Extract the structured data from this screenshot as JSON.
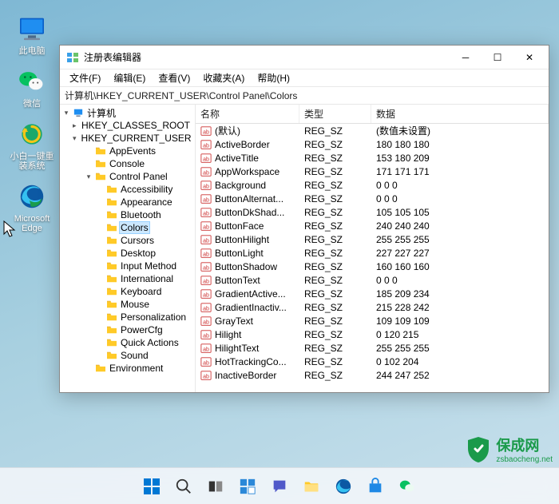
{
  "desktop": {
    "icons": [
      {
        "name": "此电脑",
        "kind": "pc"
      },
      {
        "name": "微信",
        "kind": "wechat"
      },
      {
        "name": "小白一键重装系统",
        "kind": "reinstall"
      },
      {
        "name": "Microsoft Edge",
        "kind": "edge"
      }
    ]
  },
  "window": {
    "title": "注册表编辑器",
    "menu": [
      "文件(F)",
      "编辑(E)",
      "查看(V)",
      "收藏夹(A)",
      "帮助(H)"
    ],
    "path": "计算机\\HKEY_CURRENT_USER\\Control Panel\\Colors",
    "tree_root": "计算机",
    "tree": {
      "hkcr": "HKEY_CLASSES_ROOT",
      "hkcu": "HKEY_CURRENT_USER",
      "hkcu_children": [
        "AppEvents",
        "Console",
        {
          "label": "Control Panel",
          "expanded": true,
          "children": [
            "Accessibility",
            "Appearance",
            "Bluetooth",
            {
              "label": "Colors",
              "selected": true
            },
            "Cursors",
            "Desktop",
            "Input Method",
            "International",
            "Keyboard",
            "Mouse",
            "Personalization",
            "PowerCfg",
            "Quick Actions",
            "Sound"
          ]
        },
        "Environment"
      ]
    },
    "list": {
      "headers": {
        "name": "名称",
        "type": "类型",
        "data": "数据"
      },
      "rows": [
        {
          "name": "(默认)",
          "type": "REG_SZ",
          "data": "(数值未设置)"
        },
        {
          "name": "ActiveBorder",
          "type": "REG_SZ",
          "data": "180 180 180"
        },
        {
          "name": "ActiveTitle",
          "type": "REG_SZ",
          "data": "153 180 209"
        },
        {
          "name": "AppWorkspace",
          "type": "REG_SZ",
          "data": "171 171 171"
        },
        {
          "name": "Background",
          "type": "REG_SZ",
          "data": "0 0 0"
        },
        {
          "name": "ButtonAlternat...",
          "type": "REG_SZ",
          "data": "0 0 0"
        },
        {
          "name": "ButtonDkShad...",
          "type": "REG_SZ",
          "data": "105 105 105"
        },
        {
          "name": "ButtonFace",
          "type": "REG_SZ",
          "data": "240 240 240"
        },
        {
          "name": "ButtonHilight",
          "type": "REG_SZ",
          "data": "255 255 255"
        },
        {
          "name": "ButtonLight",
          "type": "REG_SZ",
          "data": "227 227 227"
        },
        {
          "name": "ButtonShadow",
          "type": "REG_SZ",
          "data": "160 160 160"
        },
        {
          "name": "ButtonText",
          "type": "REG_SZ",
          "data": "0 0 0"
        },
        {
          "name": "GradientActive...",
          "type": "REG_SZ",
          "data": "185 209 234"
        },
        {
          "name": "GradientInactiv...",
          "type": "REG_SZ",
          "data": "215 228 242"
        },
        {
          "name": "GrayText",
          "type": "REG_SZ",
          "data": "109 109 109"
        },
        {
          "name": "Hilight",
          "type": "REG_SZ",
          "data": "0 120 215"
        },
        {
          "name": "HilightText",
          "type": "REG_SZ",
          "data": "255 255 255"
        },
        {
          "name": "HotTrackingCo...",
          "type": "REG_SZ",
          "data": "0 102 204"
        },
        {
          "name": "InactiveBorder",
          "type": "REG_SZ",
          "data": "244 247 252"
        }
      ]
    }
  },
  "taskbar": {
    "items": [
      "start",
      "search",
      "taskview",
      "widgets",
      "chat",
      "explorer",
      "edge",
      "store",
      "wechat"
    ]
  },
  "watermark": {
    "main": "保成网",
    "sub": "zsbaocheng.net"
  }
}
